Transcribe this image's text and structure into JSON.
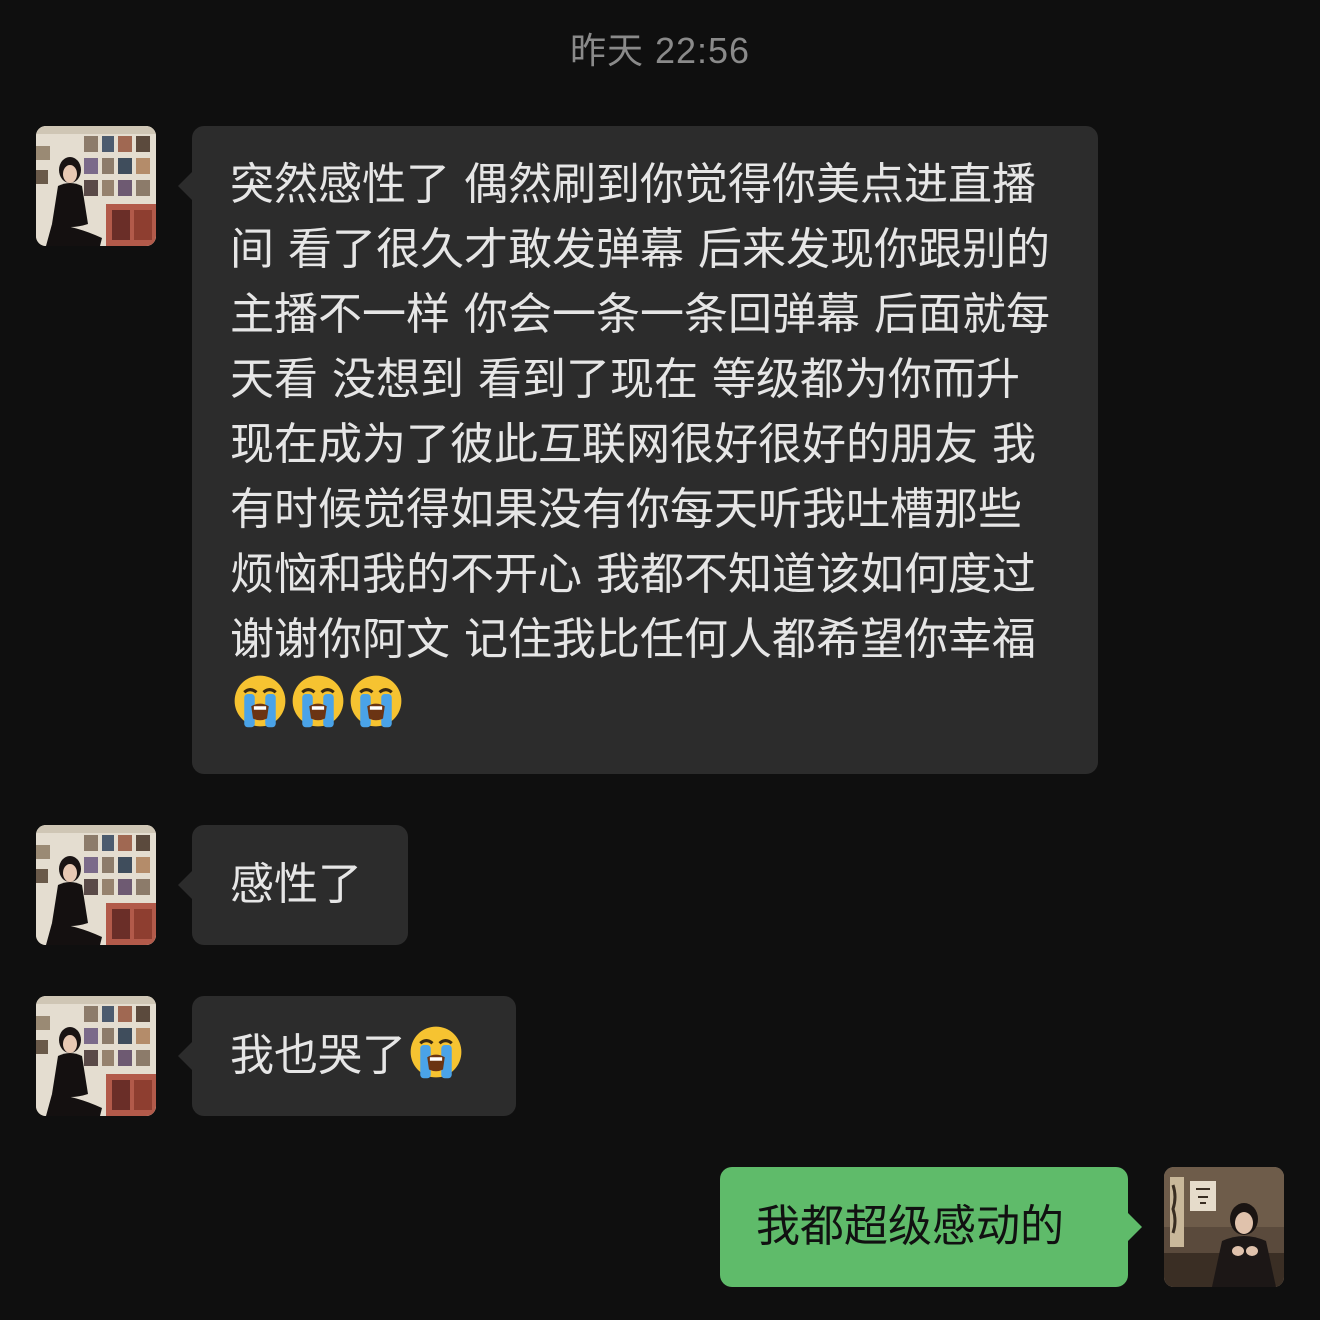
{
  "header": {
    "timestamp": "昨天 22:56"
  },
  "messages": [
    {
      "sender": "other",
      "text": "突然感性了 偶然刷到你觉得你美点进直播间 看了很久才敢发弹幕 后来发现你跟别的主播不一样 你会一条一条回弹幕 后面就每天看 没想到 看到了现在 等级都为你而升 现在成为了彼此互联网很好很好的朋友 我有时候觉得如果没有你每天听我吐槽那些烦恼和我的不开心 我都不知道该如何度过 谢谢你阿文 记住我比任何人都希望你幸福",
      "emoji": [
        "loudly-crying-face",
        "loudly-crying-face",
        "loudly-crying-face"
      ]
    },
    {
      "sender": "other",
      "text": "感性了",
      "emoji": []
    },
    {
      "sender": "other",
      "text": "我也哭了",
      "emoji": [
        "loudly-crying-face"
      ]
    },
    {
      "sender": "self",
      "text": "我都超级感动的",
      "emoji": []
    }
  ],
  "colors": {
    "background": "#0f0f0f",
    "incoming_bubble": "#2c2c2c",
    "outgoing_bubble": "#5fbb6a",
    "timestamp_text": "#8a8a8a"
  }
}
